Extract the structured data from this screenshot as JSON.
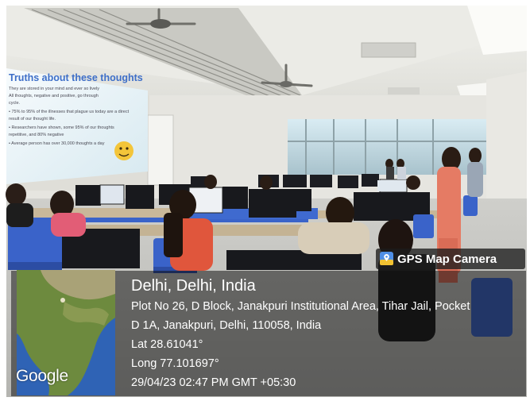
{
  "projection": {
    "title": "Truths about these thoughts",
    "lines": [
      "They are stored in your mind and ever so lively",
      "All thoughts, negative and positive, go through",
      "cycle.",
      "• 75% to 95% of the illnesses that plague us today are a direct",
      "result of our thought life.",
      "• Researchers have shown, some 95% of our thoughts",
      "repetitive, and 80% negative",
      "• Average person has over 30,000 thoughts a day"
    ]
  },
  "gps_camera": {
    "badge_label": "GPS Map Camera",
    "map_brand": "Google",
    "place": "Delhi, Delhi, India",
    "address_line1": "Plot No 26, D Block, Janakpuri Institutional Area, Tihar Jail, Pocket",
    "address_line2": "D 1A, Janakpuri, Delhi, 110058, India",
    "latitude": "Lat 28.61041°",
    "longitude": "Long 77.101697°",
    "timestamp": "29/04/23 02:47 PM GMT +05:30"
  },
  "colors": {
    "slide_title": "#3e6fc8",
    "chair_blue": "#3a63c9",
    "wall": "#e6e5e0",
    "overlay": "#0e0e0e"
  }
}
